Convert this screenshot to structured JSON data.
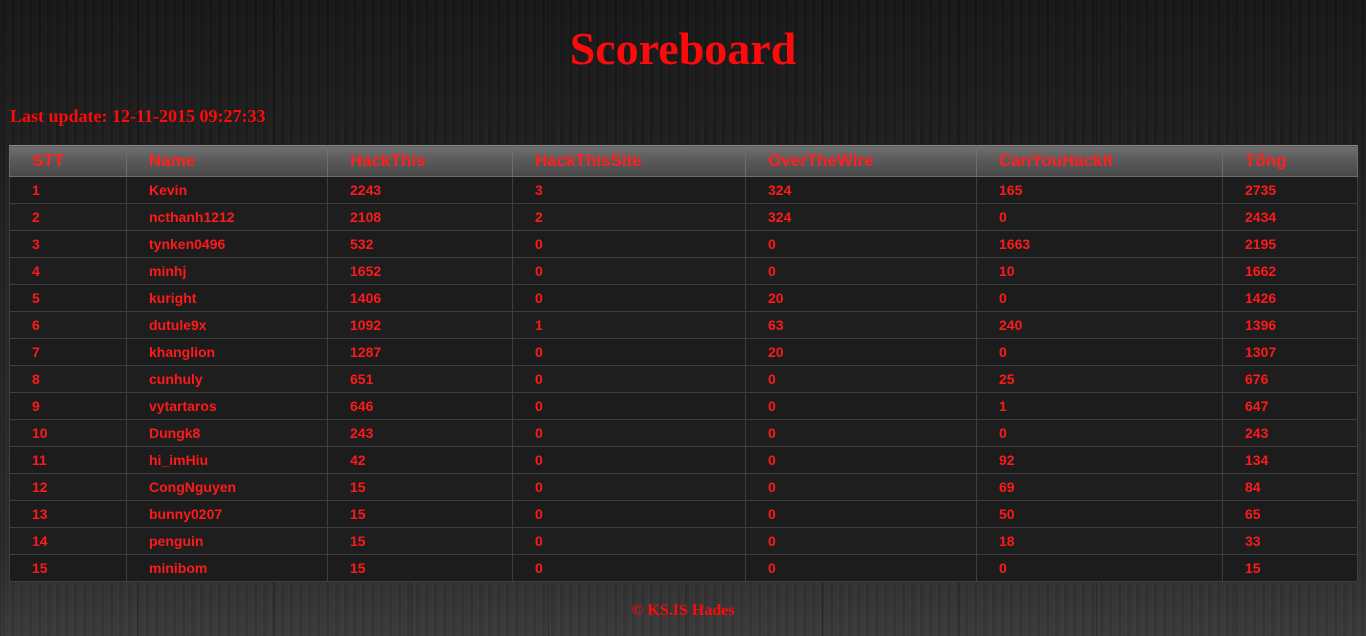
{
  "page": {
    "title": "Scoreboard",
    "last_update": "Last update: 12-11-2015 09:27:33",
    "footer": "© KS.IS Hades"
  },
  "colors": {
    "text": "#ff0000",
    "background": "#1f1f1f",
    "header_bg": "#5a5a5a"
  },
  "table": {
    "columns": [
      "STT",
      "Name",
      "HackThis",
      "HackThisSite",
      "OverTheWire",
      "CanYouHackIt",
      "Tổng"
    ],
    "rows": [
      [
        "1",
        "Kevin",
        "2243",
        "3",
        "324",
        "165",
        "2735"
      ],
      [
        "2",
        "ncthanh1212",
        "2108",
        "2",
        "324",
        "0",
        "2434"
      ],
      [
        "3",
        "tynken0496",
        "532",
        "0",
        "0",
        "1663",
        "2195"
      ],
      [
        "4",
        "minhj",
        "1652",
        "0",
        "0",
        "10",
        "1662"
      ],
      [
        "5",
        "kuright",
        "1406",
        "0",
        "20",
        "0",
        "1426"
      ],
      [
        "6",
        "dutule9x",
        "1092",
        "1",
        "63",
        "240",
        "1396"
      ],
      [
        "7",
        "khanglion",
        "1287",
        "0",
        "20",
        "0",
        "1307"
      ],
      [
        "8",
        "cunhuly",
        "651",
        "0",
        "0",
        "25",
        "676"
      ],
      [
        "9",
        "vytartaros",
        "646",
        "0",
        "0",
        "1",
        "647"
      ],
      [
        "10",
        "Dungk8",
        "243",
        "0",
        "0",
        "0",
        "243"
      ],
      [
        "11",
        "hi_imHiu",
        "42",
        "0",
        "0",
        "92",
        "134"
      ],
      [
        "12",
        "CongNguyen",
        "15",
        "0",
        "0",
        "69",
        "84"
      ],
      [
        "13",
        "bunny0207",
        "15",
        "0",
        "0",
        "50",
        "65"
      ],
      [
        "14",
        "penguin",
        "15",
        "0",
        "0",
        "18",
        "33"
      ],
      [
        "15",
        "minibom",
        "15",
        "0",
        "0",
        "0",
        "15"
      ]
    ]
  }
}
